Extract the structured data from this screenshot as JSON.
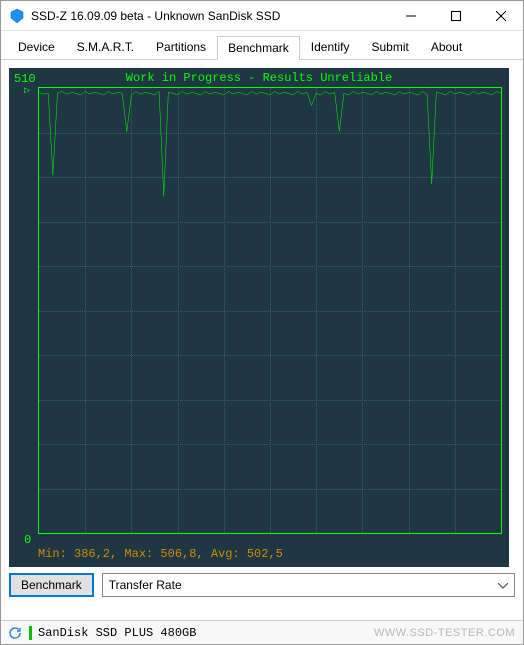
{
  "window": {
    "title": "SSD-Z 16.09.09 beta - Unknown SanDisk SSD"
  },
  "tabs": {
    "items": [
      "Device",
      "S.M.A.R.T.",
      "Partitions",
      "Benchmark",
      "Identify",
      "Submit",
      "About"
    ],
    "active_index": 3
  },
  "chart_data": {
    "type": "line",
    "title": "Work in Progress - Results Unreliable",
    "ylabel_top": "510",
    "xlabel_end": "0",
    "ylim": [
      0,
      510
    ],
    "xlim": [
      0,
      100
    ],
    "stats_text": "Min: 386,2, Max: 506,8, Avg: 502,5",
    "stats": {
      "min": 386.2,
      "max": 506.8,
      "avg": 502.5
    },
    "series": [
      {
        "name": "Transfer Rate",
        "x": [
          0,
          1,
          2,
          3,
          4,
          5,
          6,
          7,
          8,
          9,
          10,
          11,
          12,
          13,
          14,
          15,
          16,
          17,
          18,
          19,
          20,
          21,
          22,
          23,
          24,
          25,
          26,
          27,
          28,
          29,
          30,
          31,
          32,
          33,
          34,
          35,
          36,
          37,
          38,
          39,
          40,
          41,
          42,
          43,
          44,
          45,
          46,
          47,
          48,
          49,
          50,
          51,
          52,
          53,
          54,
          55,
          56,
          57,
          58,
          59,
          60,
          61,
          62,
          63,
          64,
          65,
          66,
          67,
          68,
          69,
          70,
          71,
          72,
          73,
          74,
          75,
          76,
          77,
          78,
          79,
          80,
          81,
          82,
          83,
          84,
          85,
          86,
          87,
          88,
          89,
          90,
          91,
          92,
          93,
          94,
          95,
          96,
          97,
          98,
          99,
          100
        ],
        "y": [
          505,
          503,
          504,
          410,
          504,
          506,
          503,
          505,
          504,
          502,
          506,
          503,
          505,
          504,
          502,
          506,
          503,
          505,
          504,
          460,
          502,
          506,
          503,
          505,
          504,
          502,
          506,
          386,
          505,
          504,
          502,
          506,
          503,
          505,
          504,
          502,
          506,
          503,
          505,
          504,
          502,
          506,
          503,
          505,
          504,
          502,
          506,
          503,
          505,
          504,
          502,
          506,
          503,
          505,
          504,
          502,
          506,
          503,
          505,
          490,
          504,
          502,
          506,
          503,
          505,
          460,
          504,
          502,
          506,
          503,
          505,
          504,
          502,
          506,
          503,
          505,
          504,
          502,
          506,
          503,
          505,
          504,
          502,
          506,
          503,
          400,
          505,
          504,
          502,
          506,
          503,
          505,
          504,
          502,
          506,
          503,
          505,
          504,
          502,
          506,
          504
        ]
      }
    ]
  },
  "controls": {
    "button_label": "Benchmark",
    "combo_value": "Transfer Rate"
  },
  "statusbar": {
    "text": "SanDisk SSD PLUS 480GB",
    "watermark": "WWW.SSD-TESTER.COM"
  },
  "colors": {
    "chart_bg": "#1f3742",
    "chart_line": "#00ff00",
    "chart_stats": "#cc8d00"
  }
}
